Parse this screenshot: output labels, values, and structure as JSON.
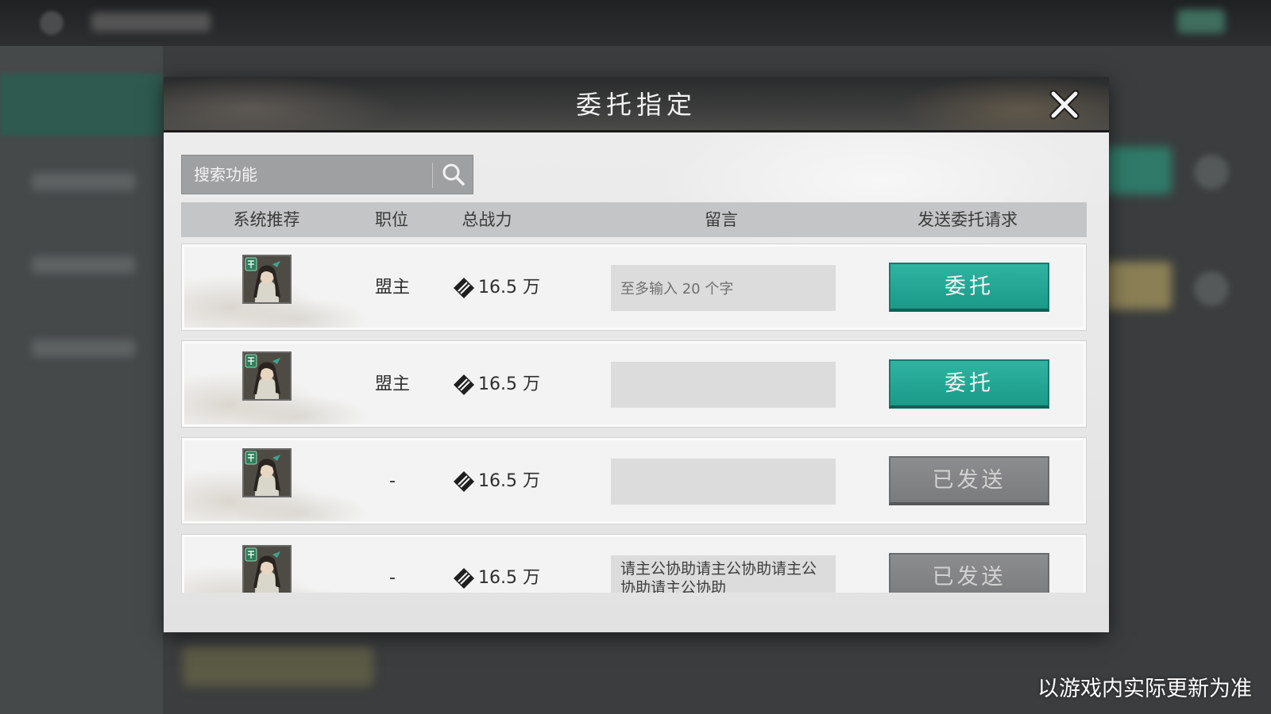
{
  "dialog": {
    "title": "委托指定",
    "search": {
      "placeholder": "搜索功能",
      "value": ""
    },
    "columns": {
      "recommend": "系统推荐",
      "position": "职位",
      "power": "总战力",
      "message": "留言",
      "send": "发送委托请求"
    },
    "rows": [
      {
        "position": "盟主",
        "power": "16.5 万",
        "message": "",
        "message_placeholder": "至多输入 20 个字",
        "button": "委托",
        "button_state": "active"
      },
      {
        "position": "盟主",
        "power": "16.5 万",
        "message": "",
        "message_placeholder": "",
        "button": "委托",
        "button_state": "active"
      },
      {
        "position": "-",
        "power": "16.5 万",
        "message": "",
        "message_placeholder": "",
        "button": "已发送",
        "button_state": "sent"
      },
      {
        "position": "-",
        "power": "16.5 万",
        "message": "请主公协助请主公协助请主公协助请主公协助",
        "message_placeholder": "",
        "button": "已发送",
        "button_state": "sent"
      }
    ]
  },
  "footer_note": "以游戏内实际更新为准",
  "colors": {
    "accent_teal": "#1fa592",
    "sent_gray": "#808182",
    "header_dark": "#2f3031"
  },
  "icons": {
    "close": "close-icon",
    "search": "search-icon",
    "power": "power-icon",
    "avatar": "general-portrait-icon"
  }
}
